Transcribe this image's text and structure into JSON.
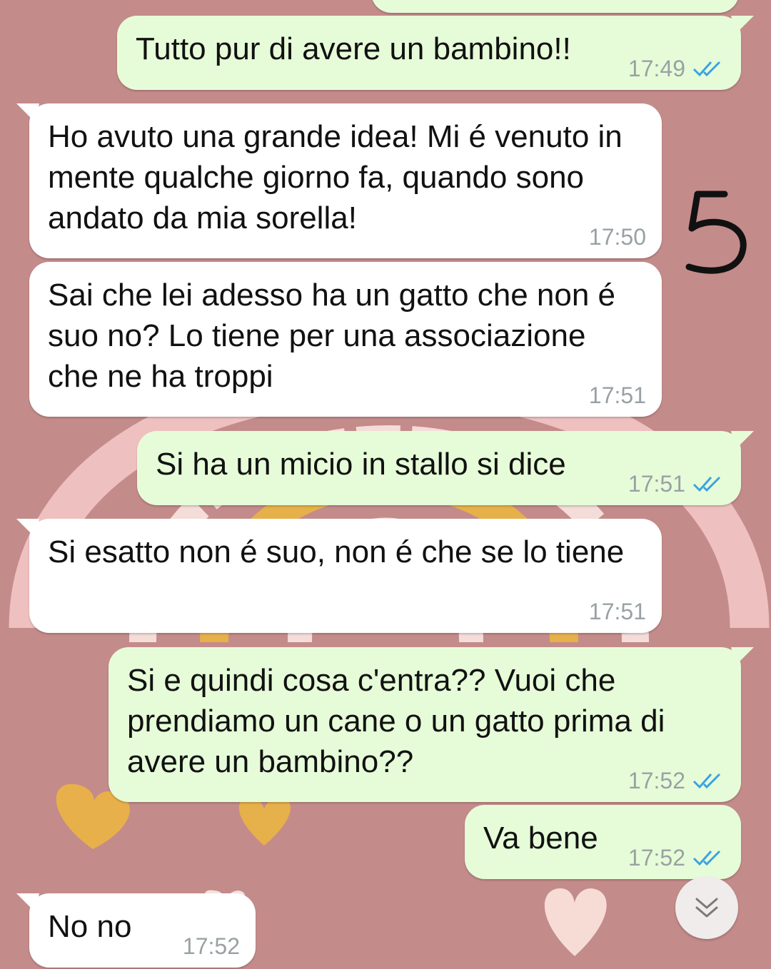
{
  "colors": {
    "wallpaper": "#c48b8b",
    "incoming_bubble": "#ffffff",
    "outgoing_bubble": "#e6fcd8",
    "read_ticks": "#3aa3e3",
    "timestamp": "#9aa1a4"
  },
  "annotation": "5",
  "messages": [
    {
      "direction": "outgoing",
      "text": "Tutto pur di avere un bambino!!",
      "time": "17:49",
      "status": "read"
    },
    {
      "direction": "incoming",
      "text": "Ho avuto una grande idea! Mi é venuto in mente qualche giorno fa, quando sono andato da mia sorella!",
      "time": "17:50"
    },
    {
      "direction": "incoming",
      "text": "Sai che lei adesso ha un gatto che non é suo no? Lo tiene per una associazione che ne ha troppi",
      "time": "17:51"
    },
    {
      "direction": "outgoing",
      "text": "Si ha un micio in stallo si dice",
      "time": "17:51",
      "status": "read"
    },
    {
      "direction": "incoming",
      "text": "Si esatto non é suo, non é che se lo tiene",
      "time": "17:51"
    },
    {
      "direction": "outgoing",
      "text": "Si e quindi cosa c'entra?? Vuoi che prendiamo un cane o un gatto prima di avere un bambino??",
      "time": "17:52",
      "status": "read"
    },
    {
      "direction": "outgoing",
      "text": "Va bene",
      "time": "17:52",
      "status": "read"
    },
    {
      "direction": "incoming",
      "text": "No no",
      "time": "17:52"
    }
  ],
  "scroll_button_icon": "double-chevron-down-icon"
}
